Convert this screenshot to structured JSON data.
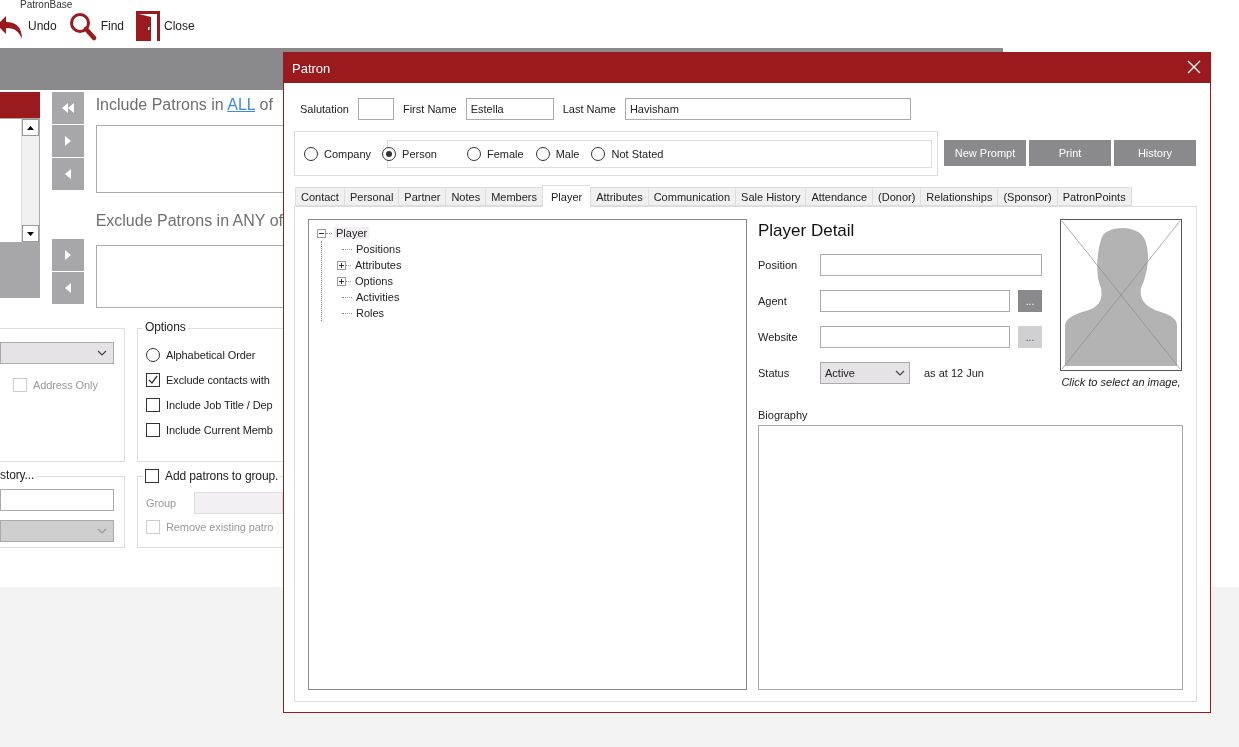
{
  "app": {
    "title": "PatronBase"
  },
  "toolbar": [
    {
      "kind": "undo",
      "label": "Undo"
    },
    {
      "kind": "find",
      "label": "Find"
    },
    {
      "kind": "close",
      "label": "Close"
    }
  ],
  "filter": {
    "include_prefix": "Include Patrons in",
    "include_link": "ALL",
    "include_suffix": "of",
    "exclude_label": "Exclude Patrons in ANY of"
  },
  "address_group": {
    "address_only": {
      "label": "Address Only",
      "checked": false,
      "disabled": true
    }
  },
  "options": {
    "title": "Options",
    "items": [
      {
        "kind": "radio",
        "label": "Alphabetical Order",
        "selected": false
      },
      {
        "kind": "checkbox",
        "label": "Exclude contacts with",
        "checked": true
      },
      {
        "kind": "checkbox",
        "label": "Include Job Title / Dep",
        "checked": false
      },
      {
        "kind": "checkbox",
        "label": "Include Current Memb",
        "checked": false
      }
    ]
  },
  "history_group": {
    "title": "story..."
  },
  "group_box": {
    "add": {
      "label": "Add patrons to group.",
      "checked": false,
      "disabled": false
    },
    "group_label": "Group",
    "remove": {
      "label": "Remove existing patro",
      "checked": false,
      "disabled": true
    }
  },
  "dialog": {
    "title": "Patron",
    "salutation_label": "Salutation",
    "first_name_label": "First Name",
    "first_name": "Estella",
    "last_name_label": "Last Name",
    "last_name": "Havisham",
    "type_options": [
      {
        "label": "Company",
        "selected": false
      },
      {
        "label": "Person",
        "selected": true
      }
    ],
    "gender_options": [
      {
        "label": "Female",
        "selected": false
      },
      {
        "label": "Male",
        "selected": false
      },
      {
        "label": "Not Stated",
        "selected": false
      }
    ],
    "buttons": [
      "New Prompt",
      "Print",
      "History"
    ],
    "tabs": [
      {
        "label": "Contact",
        "selected": false
      },
      {
        "label": "Personal",
        "selected": false
      },
      {
        "label": "Partner",
        "selected": false
      },
      {
        "label": "Notes",
        "selected": false
      },
      {
        "label": "Members",
        "selected": false
      },
      {
        "label": "Player",
        "selected": true
      },
      {
        "label": "Attributes",
        "selected": false
      },
      {
        "label": "Communication",
        "selected": false
      },
      {
        "label": "Sale History",
        "selected": false
      },
      {
        "label": "Attendance",
        "selected": false
      },
      {
        "label": "(Donor)",
        "selected": false
      },
      {
        "label": "Relationships",
        "selected": false
      },
      {
        "label": "(Sponsor)",
        "selected": false
      },
      {
        "label": "PatronPoints",
        "selected": false
      }
    ],
    "tree": {
      "kind": "branch",
      "label": "Player",
      "expanded": true,
      "children": [
        {
          "kind": "leaf",
          "label": "Positions"
        },
        {
          "kind": "branch",
          "label": "Attributes",
          "expanded": false
        },
        {
          "kind": "branch",
          "label": "Options",
          "expanded": false
        },
        {
          "kind": "leaf",
          "label": "Activities"
        },
        {
          "kind": "leaf",
          "label": "Roles"
        }
      ]
    },
    "player_detail": {
      "heading": "Player Detail",
      "fields": [
        {
          "kind": "text",
          "label": "Position"
        },
        {
          "kind": "lookup",
          "label": "Agent",
          "button": "...",
          "disabled": false
        },
        {
          "kind": "lookup",
          "label": "Website",
          "button": "...",
          "disabled": true
        },
        {
          "kind": "select",
          "label": "Status",
          "value": "Active",
          "note": "as at 12 Jun"
        }
      ],
      "image_caption": "Click to select an image,",
      "biography_label": "Biography"
    }
  }
}
